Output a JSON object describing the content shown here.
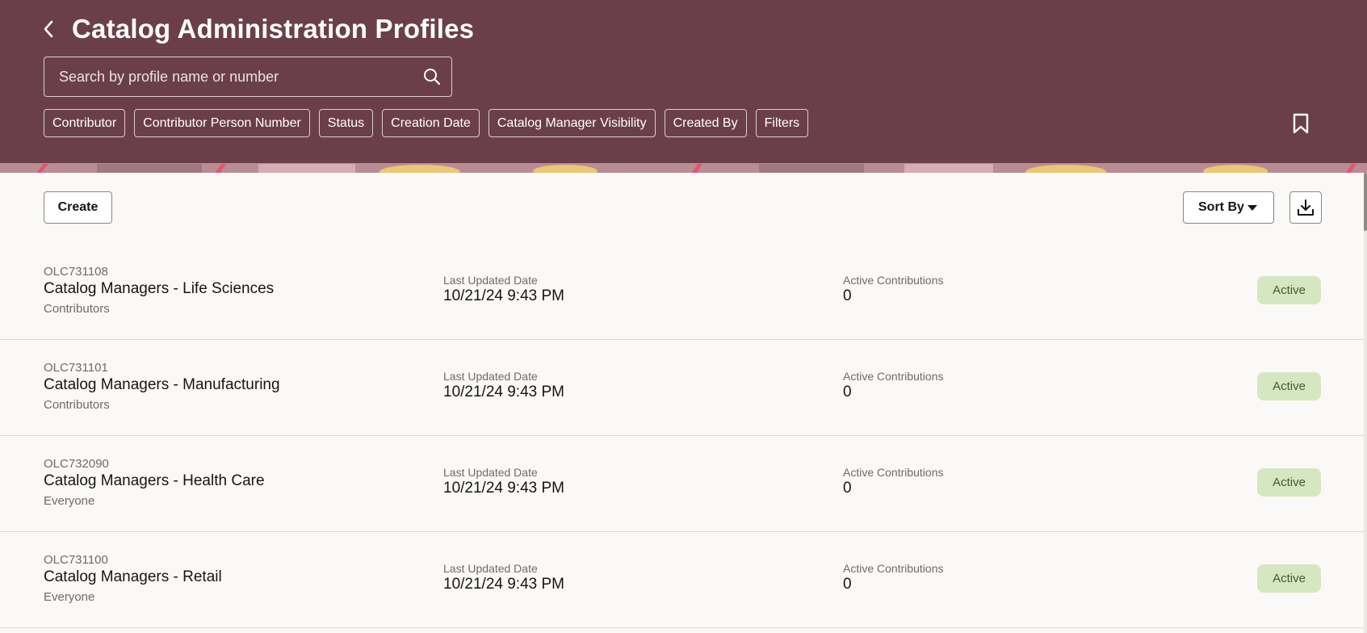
{
  "header": {
    "title": "Catalog Administration Profiles",
    "search_placeholder": "Search by profile name or number",
    "filters": [
      "Contributor",
      "Contributor Person Number",
      "Status",
      "Creation Date",
      "Catalog Manager Visibility",
      "Created By",
      "Filters"
    ]
  },
  "toolbar": {
    "create_label": "Create",
    "sort_label": "Sort By"
  },
  "profiles": [
    {
      "number": "OLC731108",
      "name": "Catalog Managers - Life Sciences",
      "audience": "Contributors",
      "updated_label": "Last Updated Date",
      "updated_value": "10/21/24 9:43 PM",
      "contrib_label": "Active Contributions",
      "contrib_value": "0",
      "status": "Active"
    },
    {
      "number": "OLC731101",
      "name": "Catalog Managers - Manufacturing",
      "audience": "Contributors",
      "updated_label": "Last Updated Date",
      "updated_value": "10/21/24 9:43 PM",
      "contrib_label": "Active Contributions",
      "contrib_value": "0",
      "status": "Active"
    },
    {
      "number": "OLC732090",
      "name": "Catalog Managers - Health Care",
      "audience": "Everyone",
      "updated_label": "Last Updated Date",
      "updated_value": "10/21/24 9:43 PM",
      "contrib_label": "Active Contributions",
      "contrib_value": "0",
      "status": "Active"
    },
    {
      "number": "OLC731100",
      "name": "Catalog Managers - Retail",
      "audience": "Everyone",
      "updated_label": "Last Updated Date",
      "updated_value": "10/21/24 9:43 PM",
      "contrib_label": "Active Contributions",
      "contrib_value": "0",
      "status": "Active"
    }
  ],
  "icons": {
    "back": "chevron-left-icon",
    "search": "search-icon",
    "bookmark": "bookmark-icon",
    "sort_caret": "caret-down-icon",
    "download": "download-icon"
  },
  "colors": {
    "header_bg": "#6b3f4a",
    "page_bg": "#faf9f7",
    "badge_bg": "#d5e7c0",
    "badge_text": "#3d5c2a"
  }
}
